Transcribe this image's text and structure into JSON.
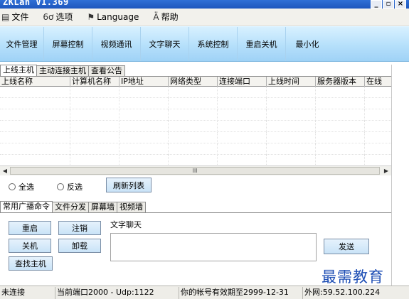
{
  "window": {
    "title": "ZKLan V1.369",
    "min_label": "_",
    "restore_label": "▫",
    "close_label": "×"
  },
  "menu": [
    {
      "icon": "▤",
      "label": "文件"
    },
    {
      "icon": "6ơ",
      "label": "选项"
    },
    {
      "icon": "⚑",
      "label": "Language"
    },
    {
      "icon": "Ä",
      "label": "帮助"
    }
  ],
  "toolbar": [
    "文件管理",
    "屏幕控制",
    "视频通讯",
    "文字聊天",
    "系统控制",
    "重启关机",
    "最小化"
  ],
  "top_tabs": [
    "上线主机",
    "主动连接主机",
    "查看公告"
  ],
  "table": {
    "columns": [
      "上线名称",
      "计算机名称",
      "IP地址",
      "网络类型",
      "连接端口",
      "上线时间",
      "服务器版本",
      "在线"
    ]
  },
  "scrollbar": {
    "left": "◀",
    "right": "▶",
    "thumb": "III"
  },
  "selection": {
    "select_all": "全选",
    "invert": "反选",
    "refresh": "刷新列表"
  },
  "bottom_tabs": [
    "常用广播命令",
    "文件分发",
    "屏幕墙",
    "视频墙"
  ],
  "commands": {
    "restart": "重启",
    "logoff": "注销",
    "shutdown": "关机",
    "uninstall": "卸载",
    "find_host": "查找主机",
    "chat_label": "文字聊天",
    "send": "发送"
  },
  "watermark": "最需教育",
  "status": {
    "conn": "未连接",
    "port": "当前端口2000 - Udp:1122",
    "expiry": "你的帐号有效期至2999-12-31",
    "external": "外网:59.52.100.224"
  }
}
